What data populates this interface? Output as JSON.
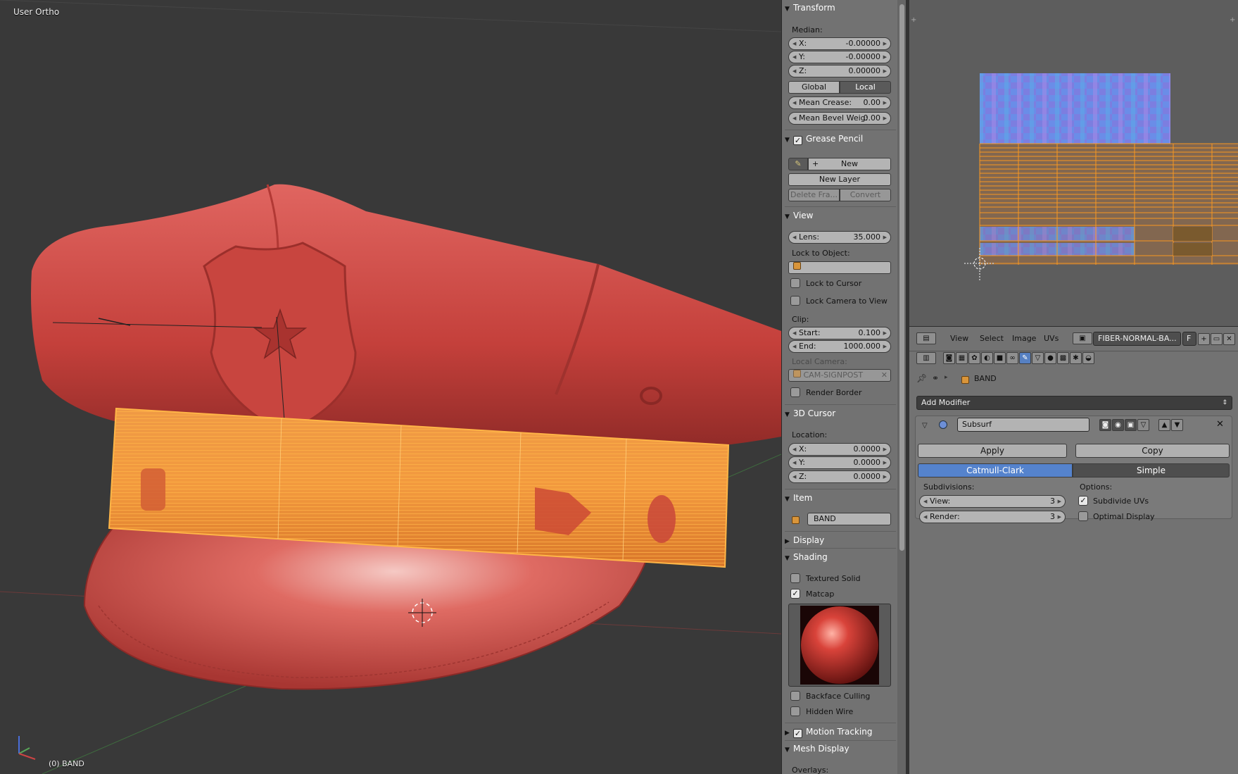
{
  "viewport": {
    "view_label": "User Ortho",
    "status_label": "(0) BAND"
  },
  "npanel": {
    "transform": {
      "title": "Transform",
      "median_label": "Median:",
      "x": {
        "label": "X:",
        "value": "-0.00000"
      },
      "y": {
        "label": "Y:",
        "value": "-0.00000"
      },
      "z": {
        "label": "Z:",
        "value": "0.00000"
      },
      "global": "Global",
      "local": "Local",
      "crease": {
        "label": "Mean Crease:",
        "value": "0.00"
      },
      "bevel": {
        "label": "Mean Bevel Weig:",
        "value": "0.00"
      }
    },
    "grease": {
      "title": "Grease Pencil",
      "new": "New",
      "new_layer": "New Layer",
      "delete_frame": "Delete Fra...",
      "convert": "Convert"
    },
    "view": {
      "title": "View",
      "lens": {
        "label": "Lens:",
        "value": "35.000"
      },
      "lock_object": "Lock to Object:",
      "lock_cursor": "Lock to Cursor",
      "lock_camera": "Lock Camera to View",
      "clip": "Clip:",
      "start": {
        "label": "Start:",
        "value": "0.100"
      },
      "end": {
        "label": "End:",
        "value": "1000.000"
      },
      "local_camera": "Local Camera:",
      "camera_name": "CAM-SIGNPOST",
      "render_border": "Render Border"
    },
    "cursor": {
      "title": "3D Cursor",
      "location": "Location:",
      "x": {
        "label": "X:",
        "value": "0.0000"
      },
      "y": {
        "label": "Y:",
        "value": "0.0000"
      },
      "z": {
        "label": "Z:",
        "value": "0.0000"
      }
    },
    "item": {
      "title": "Item",
      "name": "BAND"
    },
    "display": {
      "title": "Display"
    },
    "shading": {
      "title": "Shading",
      "textured_solid": "Textured Solid",
      "matcap": "Matcap",
      "backface": "Backface Culling",
      "hidden_wire": "Hidden Wire"
    },
    "motion": {
      "title": "Motion Tracking"
    },
    "mesh": {
      "title": "Mesh Display",
      "overlays": "Overlays:"
    }
  },
  "uv_editor": {
    "menus": {
      "view": "View",
      "select": "Select",
      "image": "Image",
      "uvs": "UVs"
    },
    "image_name": "FIBER-NORMAL-BA...",
    "fake_label": "F"
  },
  "properties": {
    "object_name": "BAND",
    "add_modifier": "Add Modifier",
    "modifier_name": "Subsurf",
    "apply": "Apply",
    "copy": "Copy",
    "catmull": "Catmull-Clark",
    "simple": "Simple",
    "subdivisions": "Subdivisions:",
    "view": {
      "label": "View:",
      "value": "3"
    },
    "render": {
      "label": "Render:",
      "value": "3"
    },
    "options": "Options:",
    "subdivide_uvs": "Subdivide UVs",
    "optimal_display": "Optimal Display"
  },
  "colors": {
    "accent_blue": "#5583cd",
    "selection_orange": "#ff9a1f",
    "hat_red": "#c8453f"
  }
}
